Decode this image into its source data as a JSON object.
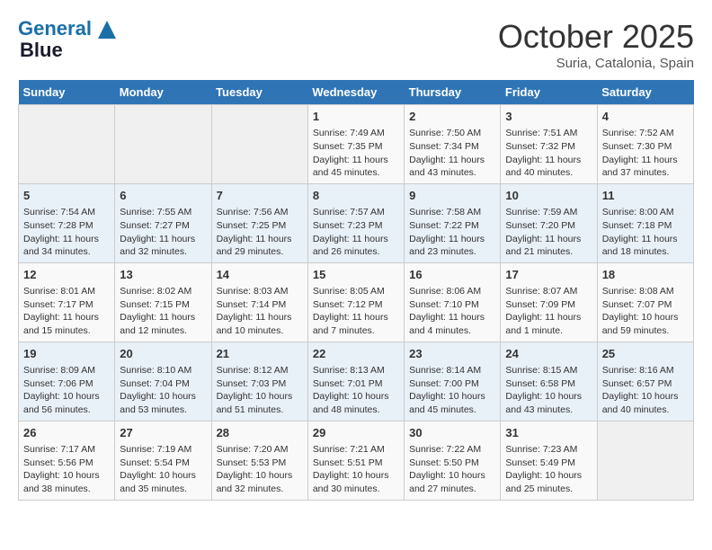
{
  "logo": {
    "line1": "General",
    "line2": "Blue"
  },
  "title": "October 2025",
  "subtitle": "Suria, Catalonia, Spain",
  "headers": [
    "Sunday",
    "Monday",
    "Tuesday",
    "Wednesday",
    "Thursday",
    "Friday",
    "Saturday"
  ],
  "weeks": [
    [
      {
        "day": "",
        "sunrise": "",
        "sunset": "",
        "daylight": ""
      },
      {
        "day": "",
        "sunrise": "",
        "sunset": "",
        "daylight": ""
      },
      {
        "day": "",
        "sunrise": "",
        "sunset": "",
        "daylight": ""
      },
      {
        "day": "1",
        "sunrise": "Sunrise: 7:49 AM",
        "sunset": "Sunset: 7:35 PM",
        "daylight": "Daylight: 11 hours and 45 minutes."
      },
      {
        "day": "2",
        "sunrise": "Sunrise: 7:50 AM",
        "sunset": "Sunset: 7:34 PM",
        "daylight": "Daylight: 11 hours and 43 minutes."
      },
      {
        "day": "3",
        "sunrise": "Sunrise: 7:51 AM",
        "sunset": "Sunset: 7:32 PM",
        "daylight": "Daylight: 11 hours and 40 minutes."
      },
      {
        "day": "4",
        "sunrise": "Sunrise: 7:52 AM",
        "sunset": "Sunset: 7:30 PM",
        "daylight": "Daylight: 11 hours and 37 minutes."
      }
    ],
    [
      {
        "day": "5",
        "sunrise": "Sunrise: 7:54 AM",
        "sunset": "Sunset: 7:28 PM",
        "daylight": "Daylight: 11 hours and 34 minutes."
      },
      {
        "day": "6",
        "sunrise": "Sunrise: 7:55 AM",
        "sunset": "Sunset: 7:27 PM",
        "daylight": "Daylight: 11 hours and 32 minutes."
      },
      {
        "day": "7",
        "sunrise": "Sunrise: 7:56 AM",
        "sunset": "Sunset: 7:25 PM",
        "daylight": "Daylight: 11 hours and 29 minutes."
      },
      {
        "day": "8",
        "sunrise": "Sunrise: 7:57 AM",
        "sunset": "Sunset: 7:23 PM",
        "daylight": "Daylight: 11 hours and 26 minutes."
      },
      {
        "day": "9",
        "sunrise": "Sunrise: 7:58 AM",
        "sunset": "Sunset: 7:22 PM",
        "daylight": "Daylight: 11 hours and 23 minutes."
      },
      {
        "day": "10",
        "sunrise": "Sunrise: 7:59 AM",
        "sunset": "Sunset: 7:20 PM",
        "daylight": "Daylight: 11 hours and 21 minutes."
      },
      {
        "day": "11",
        "sunrise": "Sunrise: 8:00 AM",
        "sunset": "Sunset: 7:18 PM",
        "daylight": "Daylight: 11 hours and 18 minutes."
      }
    ],
    [
      {
        "day": "12",
        "sunrise": "Sunrise: 8:01 AM",
        "sunset": "Sunset: 7:17 PM",
        "daylight": "Daylight: 11 hours and 15 minutes."
      },
      {
        "day": "13",
        "sunrise": "Sunrise: 8:02 AM",
        "sunset": "Sunset: 7:15 PM",
        "daylight": "Daylight: 11 hours and 12 minutes."
      },
      {
        "day": "14",
        "sunrise": "Sunrise: 8:03 AM",
        "sunset": "Sunset: 7:14 PM",
        "daylight": "Daylight: 11 hours and 10 minutes."
      },
      {
        "day": "15",
        "sunrise": "Sunrise: 8:05 AM",
        "sunset": "Sunset: 7:12 PM",
        "daylight": "Daylight: 11 hours and 7 minutes."
      },
      {
        "day": "16",
        "sunrise": "Sunrise: 8:06 AM",
        "sunset": "Sunset: 7:10 PM",
        "daylight": "Daylight: 11 hours and 4 minutes."
      },
      {
        "day": "17",
        "sunrise": "Sunrise: 8:07 AM",
        "sunset": "Sunset: 7:09 PM",
        "daylight": "Daylight: 11 hours and 1 minute."
      },
      {
        "day": "18",
        "sunrise": "Sunrise: 8:08 AM",
        "sunset": "Sunset: 7:07 PM",
        "daylight": "Daylight: 10 hours and 59 minutes."
      }
    ],
    [
      {
        "day": "19",
        "sunrise": "Sunrise: 8:09 AM",
        "sunset": "Sunset: 7:06 PM",
        "daylight": "Daylight: 10 hours and 56 minutes."
      },
      {
        "day": "20",
        "sunrise": "Sunrise: 8:10 AM",
        "sunset": "Sunset: 7:04 PM",
        "daylight": "Daylight: 10 hours and 53 minutes."
      },
      {
        "day": "21",
        "sunrise": "Sunrise: 8:12 AM",
        "sunset": "Sunset: 7:03 PM",
        "daylight": "Daylight: 10 hours and 51 minutes."
      },
      {
        "day": "22",
        "sunrise": "Sunrise: 8:13 AM",
        "sunset": "Sunset: 7:01 PM",
        "daylight": "Daylight: 10 hours and 48 minutes."
      },
      {
        "day": "23",
        "sunrise": "Sunrise: 8:14 AM",
        "sunset": "Sunset: 7:00 PM",
        "daylight": "Daylight: 10 hours and 45 minutes."
      },
      {
        "day": "24",
        "sunrise": "Sunrise: 8:15 AM",
        "sunset": "Sunset: 6:58 PM",
        "daylight": "Daylight: 10 hours and 43 minutes."
      },
      {
        "day": "25",
        "sunrise": "Sunrise: 8:16 AM",
        "sunset": "Sunset: 6:57 PM",
        "daylight": "Daylight: 10 hours and 40 minutes."
      }
    ],
    [
      {
        "day": "26",
        "sunrise": "Sunrise: 7:17 AM",
        "sunset": "Sunset: 5:56 PM",
        "daylight": "Daylight: 10 hours and 38 minutes."
      },
      {
        "day": "27",
        "sunrise": "Sunrise: 7:19 AM",
        "sunset": "Sunset: 5:54 PM",
        "daylight": "Daylight: 10 hours and 35 minutes."
      },
      {
        "day": "28",
        "sunrise": "Sunrise: 7:20 AM",
        "sunset": "Sunset: 5:53 PM",
        "daylight": "Daylight: 10 hours and 32 minutes."
      },
      {
        "day": "29",
        "sunrise": "Sunrise: 7:21 AM",
        "sunset": "Sunset: 5:51 PM",
        "daylight": "Daylight: 10 hours and 30 minutes."
      },
      {
        "day": "30",
        "sunrise": "Sunrise: 7:22 AM",
        "sunset": "Sunset: 5:50 PM",
        "daylight": "Daylight: 10 hours and 27 minutes."
      },
      {
        "day": "31",
        "sunrise": "Sunrise: 7:23 AM",
        "sunset": "Sunset: 5:49 PM",
        "daylight": "Daylight: 10 hours and 25 minutes."
      },
      {
        "day": "",
        "sunrise": "",
        "sunset": "",
        "daylight": ""
      }
    ]
  ]
}
